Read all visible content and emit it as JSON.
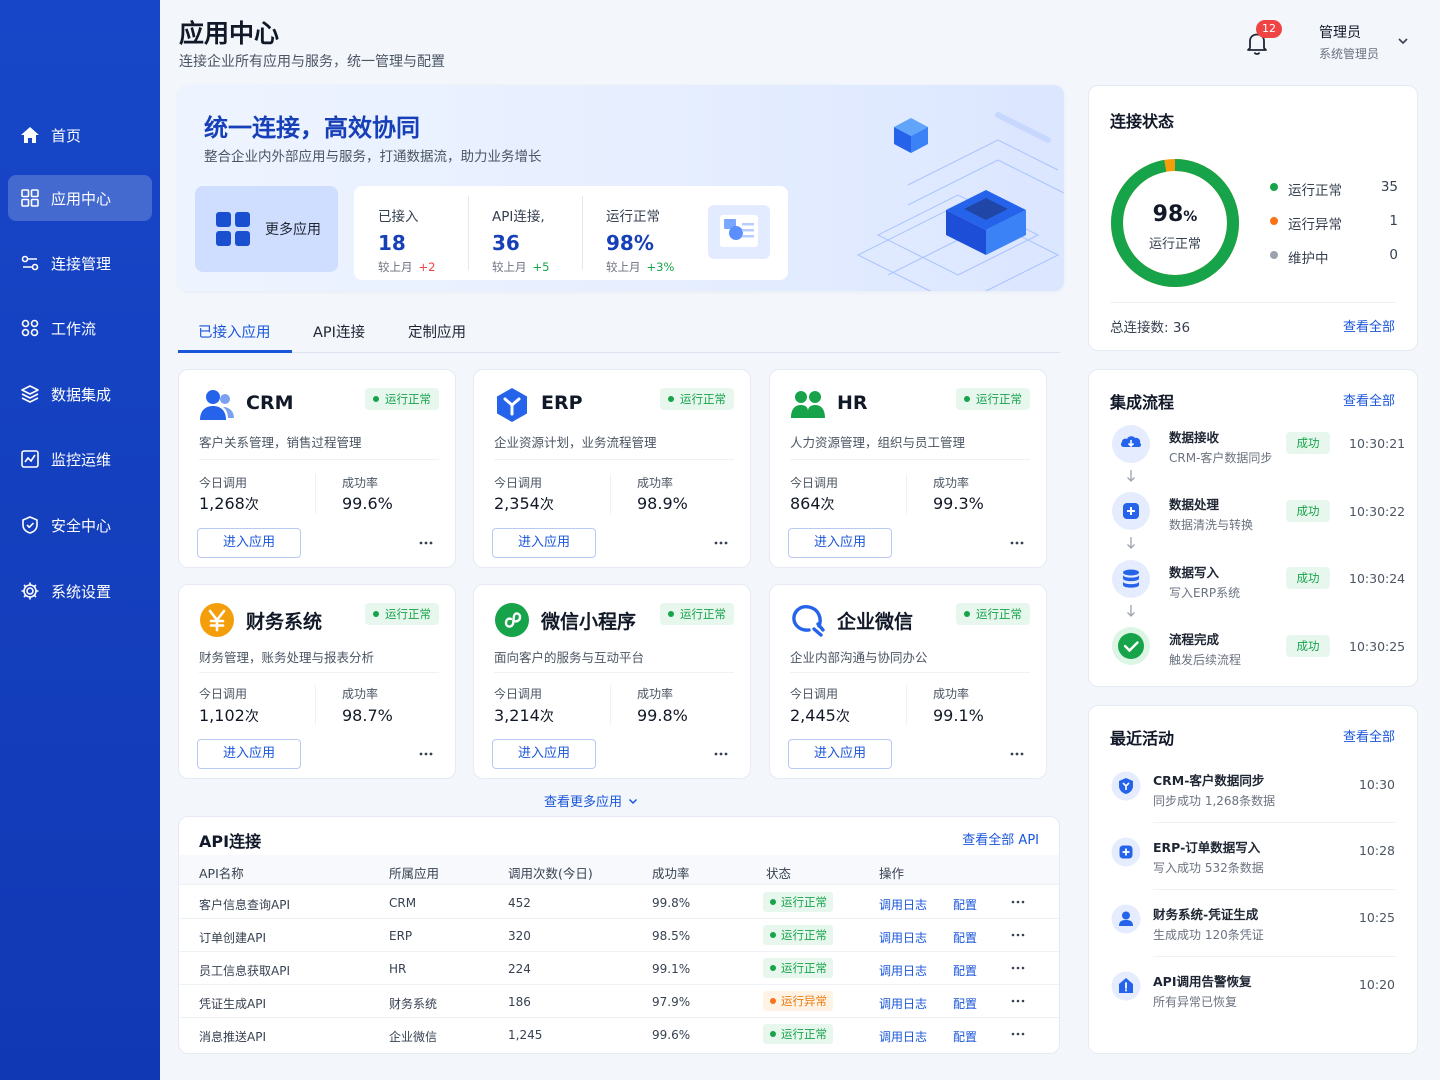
{
  "header": {
    "title": "应用中心",
    "subtitle": "连接企业所有应用与服务，统一管理与配置",
    "notifications": "12",
    "user_name": "管理员",
    "user_role": "系统管理员"
  },
  "sidebar": {
    "items": [
      {
        "label": "首页",
        "icon": "home-icon"
      },
      {
        "label": "应用中心",
        "icon": "grid-icon",
        "active": true
      },
      {
        "label": "连接管理",
        "icon": "link-icon"
      },
      {
        "label": "工作流",
        "icon": "workflow-icon"
      },
      {
        "label": "数据集成",
        "icon": "layers-icon"
      },
      {
        "label": "监控运维",
        "icon": "monitor-chart-icon"
      },
      {
        "label": "安全中心",
        "icon": "shield-icon"
      },
      {
        "label": "系统设置",
        "icon": "gear-icon"
      }
    ]
  },
  "banner": {
    "title": "统一连接，高效协同",
    "subtitle": "整合企业内外部应用与服务，打通数据流，助力业务增长",
    "more_apps": "更多应用",
    "stats": [
      {
        "label": "已接入",
        "value": "18",
        "compare": "较上月",
        "delta": "+2",
        "delta_color": "#ef4444"
      },
      {
        "label": "API连接,",
        "value": "36",
        "compare": "较上月",
        "delta": "+5",
        "delta_color": "#16a34a"
      },
      {
        "label": "运行正常",
        "value": "98%",
        "compare": "较上月",
        "delta": "+3%",
        "delta_color": "#16a34a"
      }
    ]
  },
  "tabs": [
    {
      "label": "已接入应用",
      "active": true
    },
    {
      "label": "API连接"
    },
    {
      "label": "定制应用"
    }
  ],
  "cards_common": {
    "calls_label": "今日调用",
    "rate_label": "成功率",
    "enter_label": "进入应用"
  },
  "app_cards": [
    {
      "name": "CRM",
      "status": "运行正常",
      "desc": "客户关系管理，销售过程管理",
      "calls": "1,268",
      "unit": "次",
      "rate": "99.6%",
      "icon": "users-icon"
    },
    {
      "name": "ERP",
      "status": "运行正常",
      "desc": "企业资源计划，业务流程管理",
      "calls": "2,354",
      "unit": "次",
      "rate": "98.9%",
      "icon": "hexagon-y-icon"
    },
    {
      "name": "HR",
      "status": "运行正常",
      "desc": "人力资源管理，组织与员工管理",
      "calls": "864",
      "unit": "次",
      "rate": "99.3%",
      "icon": "people-icon"
    },
    {
      "name": "财务系统",
      "status": "运行正常",
      "desc": "财务管理，账务处理与报表分析",
      "calls": "1,102",
      "unit": "次",
      "rate": "98.7%",
      "icon": "yen-icon"
    },
    {
      "name": "微信小程序",
      "status": "运行正常",
      "desc": "面向客户的服务与互动平台",
      "calls": "3,214",
      "unit": "次",
      "rate": "99.8%",
      "icon": "miniprogram-icon"
    },
    {
      "name": "企业微信",
      "status": "运行正常",
      "desc": "企业内部沟通与协同办公",
      "calls": "2,445",
      "unit": "次",
      "rate": "99.1%",
      "icon": "wecom-icon"
    }
  ],
  "see_more": "查看更多应用",
  "api": {
    "title": "API连接",
    "view_all": "查看全部 API",
    "columns": [
      "API名称",
      "所属应用",
      "调用次数(今日)",
      "成功率",
      "状态",
      "操作"
    ],
    "log_label": "调用日志",
    "config_label": "配置",
    "rows": [
      {
        "name": "客户信息查询API",
        "app": "CRM",
        "calls": "452",
        "rate": "99.8%",
        "status": "运行正常",
        "level": "ok"
      },
      {
        "name": "订单创建API",
        "app": "ERP",
        "calls": "320",
        "rate": "98.5%",
        "status": "运行正常",
        "level": "ok"
      },
      {
        "name": "员工信息获取API",
        "app": "HR",
        "calls": "224",
        "rate": "99.1%",
        "status": "运行正常",
        "level": "ok"
      },
      {
        "name": "凭证生成API",
        "app": "财务系统",
        "calls": "186",
        "rate": "97.9%",
        "status": "运行异常",
        "level": "warn"
      },
      {
        "name": "消息推送API",
        "app": "企业微信",
        "calls": "1,245",
        "rate": "99.6%",
        "status": "运行正常",
        "level": "ok"
      }
    ]
  },
  "connection": {
    "title": "连接状态",
    "percent": "98",
    "percent_unit": "%",
    "ring_fill": 0.972,
    "center_label": "运行正常",
    "legend": [
      {
        "label": "运行正常",
        "value": "35",
        "color": "#16a34a"
      },
      {
        "label": "运行异常",
        "value": "1",
        "color": "#f97316"
      },
      {
        "label": "维护中",
        "value": "0",
        "color": "#9ca3af"
      }
    ],
    "total_label": "总连接数:",
    "total": "36",
    "view_all": "查看全部"
  },
  "flow": {
    "title": "集成流程",
    "view_all": "查看全部",
    "steps": [
      {
        "title": "数据接收",
        "sub": "CRM-客户数据同步",
        "status": "成功",
        "time": "10:30:21",
        "icon": "cloud-download-icon"
      },
      {
        "title": "数据处理",
        "sub": "数据清洗与转换",
        "status": "成功",
        "time": "10:30:22",
        "icon": "plus-box-icon"
      },
      {
        "title": "数据写入",
        "sub": "写入ERP系统",
        "status": "成功",
        "time": "10:30:24",
        "icon": "database-icon"
      },
      {
        "title": "流程完成",
        "sub": "触发后续流程",
        "status": "成功",
        "time": "10:30:25",
        "icon": "check-circle-icon"
      }
    ]
  },
  "activity": {
    "title": "最近活动",
    "view_all": "查看全部",
    "items": [
      {
        "title": "CRM-客户数据同步",
        "sub": "同步成功 1,268条数据",
        "time": "10:30",
        "icon": "shield-y-icon"
      },
      {
        "title": "ERP-订单数据写入",
        "sub": "写入成功 532条数据",
        "time": "10:28",
        "icon": "plus-box-icon"
      },
      {
        "title": "财务系统-凭证生成",
        "sub": "生成成功 120条凭证",
        "time": "10:25",
        "icon": "person-icon"
      },
      {
        "title": "API调用告警恢复",
        "sub": "所有异常已恢复",
        "time": "10:20",
        "icon": "bell-home-icon"
      }
    ]
  }
}
